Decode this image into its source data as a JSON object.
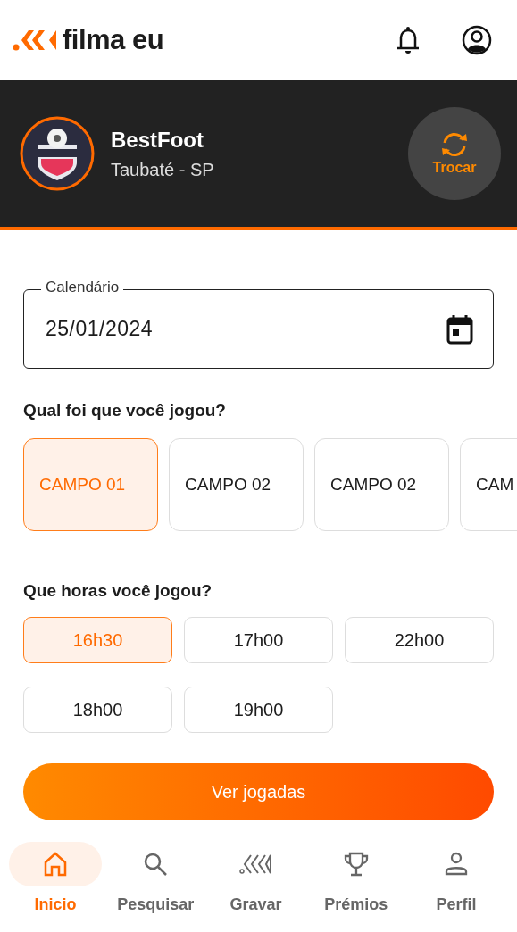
{
  "app_bar": {
    "brand": "filma eu"
  },
  "team": {
    "name": "BestFoot",
    "location": "Taubaté - SP",
    "switch_label": "Trocar"
  },
  "date_field": {
    "label": "Calendário",
    "value": "25/01/2024"
  },
  "field_question": "Qual foi que você jogou?",
  "fields": [
    {
      "label": "CAMPO 01",
      "selected": true
    },
    {
      "label": "CAMPO 02",
      "selected": false
    },
    {
      "label": "CAMPO 02",
      "selected": false
    },
    {
      "label": "CAM",
      "selected": false
    }
  ],
  "time_question": "Que horas você jogou?",
  "times": [
    {
      "label": "16h30",
      "selected": true
    },
    {
      "label": "17h00",
      "selected": false
    },
    {
      "label": "22h00",
      "selected": false
    },
    {
      "label": "18h00",
      "selected": false
    },
    {
      "label": "19h00",
      "selected": false
    }
  ],
  "submit_label": "Ver jogadas",
  "bottom_nav": [
    {
      "label": "Inicio",
      "kind": "home",
      "selected": true
    },
    {
      "label": "Pesquisar",
      "kind": "search",
      "selected": false
    },
    {
      "label": "Gravar",
      "kind": "record",
      "selected": false
    },
    {
      "label": "Prémios",
      "kind": "trophy",
      "selected": false
    },
    {
      "label": "Perfil",
      "kind": "person",
      "selected": false
    }
  ]
}
